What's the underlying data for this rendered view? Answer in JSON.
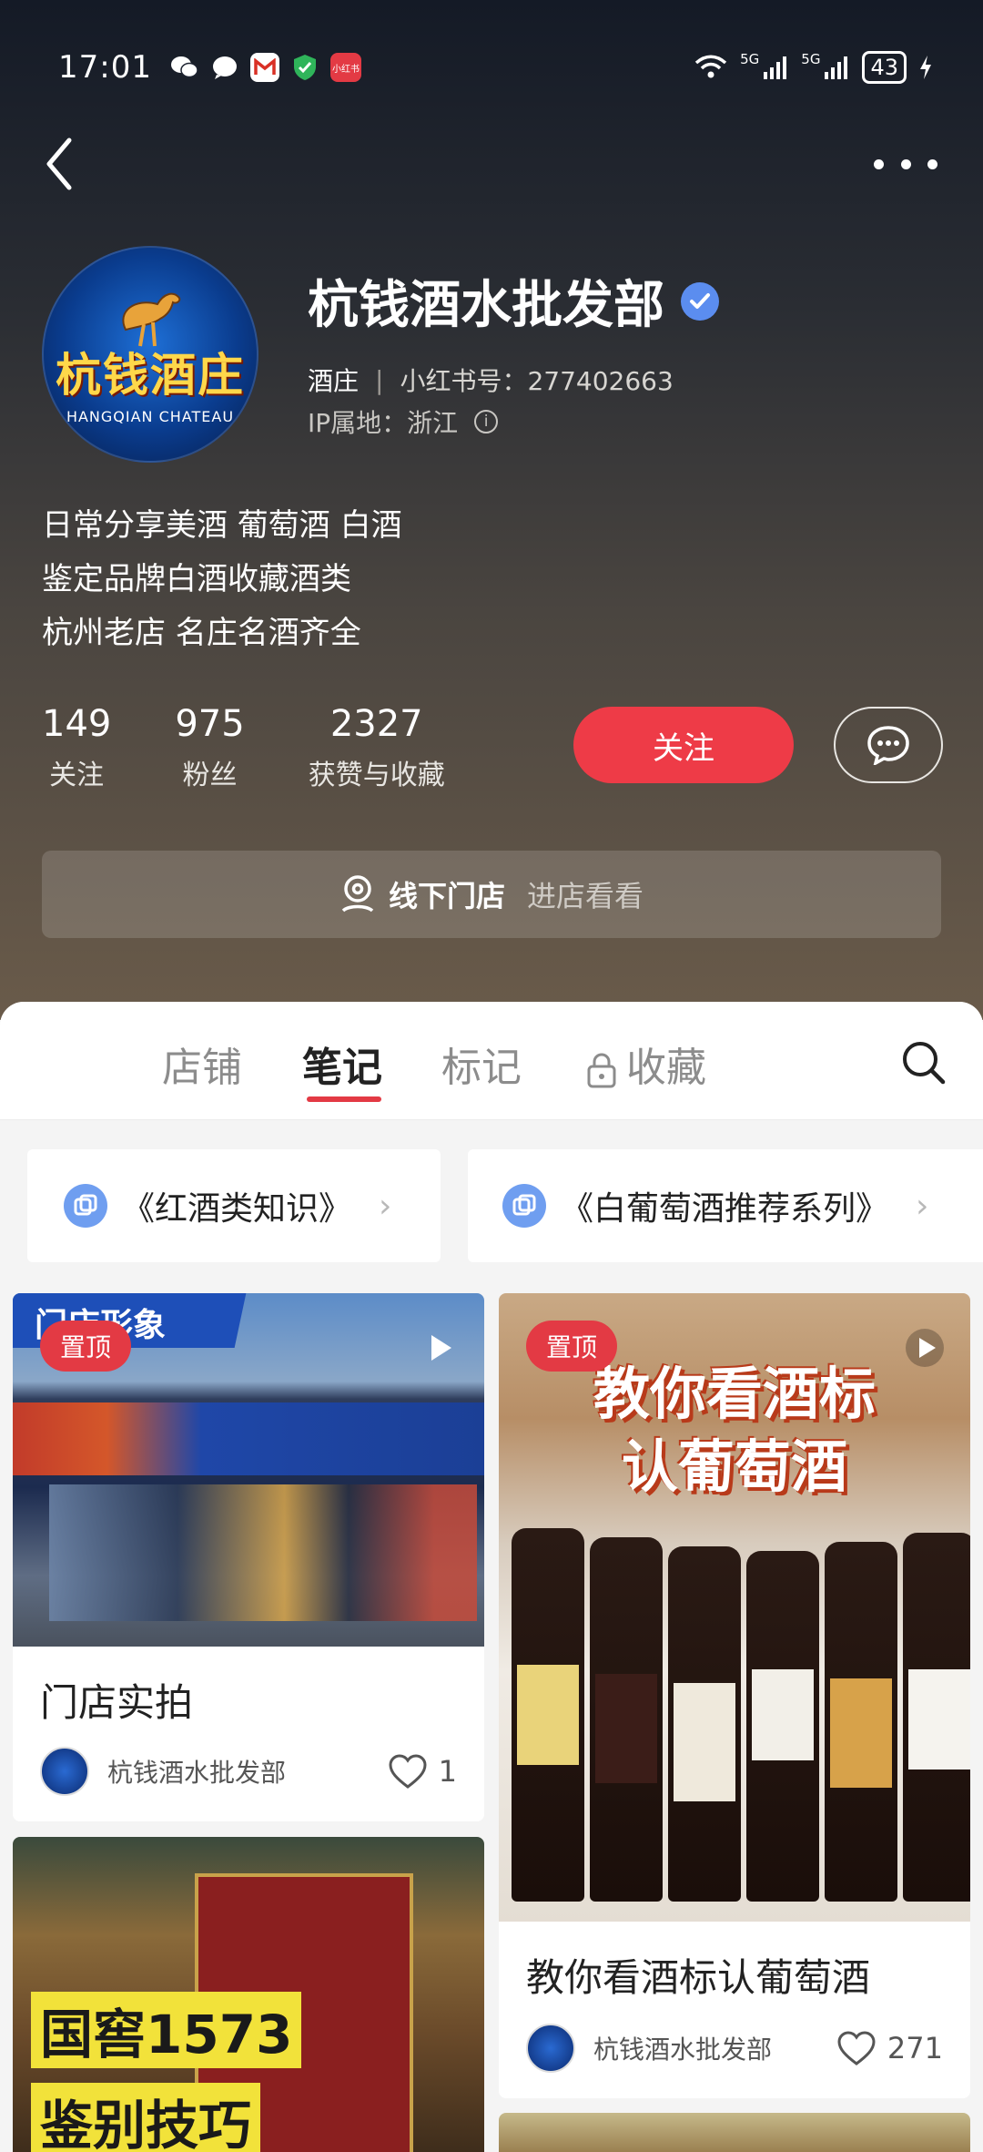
{
  "status_bar": {
    "time": "17:01",
    "network_label": "5G",
    "battery": "43",
    "app_badge": "小红书"
  },
  "profile": {
    "name": "杭钱酒水批发部",
    "avatar_text_cn": "杭钱酒庄",
    "avatar_text_en": "HANGQIAN CHATEAU",
    "type": "酒庄",
    "id_label": "小红书号：277402663",
    "ip_label": "IP属地：浙江",
    "bio": [
      "日常分享美酒 葡萄酒 白酒",
      "鉴定品牌白酒收藏酒类",
      "杭州老店 名庄名酒齐全"
    ]
  },
  "stats": [
    {
      "num": "149",
      "label": "关注"
    },
    {
      "num": "975",
      "label": "粉丝"
    },
    {
      "num": "2327",
      "label": "获赞与收藏"
    }
  ],
  "buttons": {
    "follow": "关注"
  },
  "store_bar": {
    "title": "线下门店",
    "action": "进店看看"
  },
  "tabs": [
    {
      "label": "店铺"
    },
    {
      "label": "笔记",
      "active": true
    },
    {
      "label": "标记"
    },
    {
      "label": "收藏",
      "locked": true
    }
  ],
  "collections": [
    {
      "label": "《红酒类知识》"
    },
    {
      "label": "《白葡萄酒推荐系列》"
    }
  ],
  "notes": [
    {
      "pin": "置顶",
      "img_caption": "门店形象",
      "title": "门店实拍",
      "author": "杭钱酒水批发部",
      "likes": "1"
    },
    {
      "pin": "置顶",
      "img_line1": "教你看酒标",
      "img_line2": "认葡萄酒",
      "title": "教你看酒标认葡萄酒",
      "author": "杭钱酒水批发部",
      "likes": "271"
    },
    {
      "img_line1": "国窖1573",
      "img_line2": "鉴别技巧"
    }
  ],
  "colors": {
    "accent": "#ee3b47",
    "verified": "#5b8def",
    "collection_icon": "#6f9ef0"
  }
}
